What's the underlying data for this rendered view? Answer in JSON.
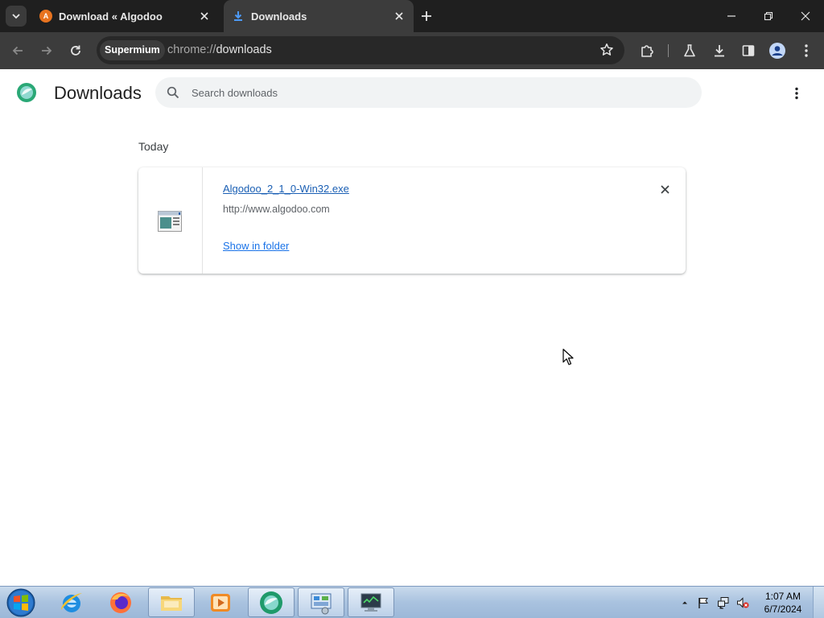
{
  "browser": {
    "tabs": [
      {
        "title": "Download « Algodoo",
        "favicon": "algodoo-favicon"
      },
      {
        "title": "Downloads",
        "favicon": "download-favicon",
        "active": true
      }
    ],
    "address": {
      "chip": "Supermium",
      "scheme": "chrome://",
      "path": "downloads"
    },
    "icons": [
      "tab-search-icon",
      "new-tab-icon",
      "minimize-icon",
      "restore-icon",
      "close-window-icon",
      "back-icon",
      "forward-icon",
      "reload-icon",
      "bookmark-star-icon",
      "extensions-icon",
      "labs-icon",
      "downloads-icon",
      "side-panel-icon",
      "profile-icon",
      "browser-menu-icon"
    ]
  },
  "page": {
    "title": "Downloads",
    "search_placeholder": "Search downloads",
    "section": "Today",
    "item": {
      "filename": "Algodoo_2_1_0-Win32.exe",
      "source_url": "http://www.algodoo.com",
      "action": "Show in folder"
    }
  },
  "taskbar": {
    "apps": [
      "start-orb",
      "internet-explorer",
      "firefox",
      "file-explorer",
      "media-player",
      "algodoo",
      "control-panel",
      "network-monitor"
    ],
    "clock": {
      "time": "1:07 AM",
      "date": "6/7/2024"
    }
  },
  "colors": {
    "tabstrip": "#1f1f1f",
    "toolbar": "#3c3c3c",
    "link": "#1a73e8",
    "taskbar": "#a9c2df"
  }
}
